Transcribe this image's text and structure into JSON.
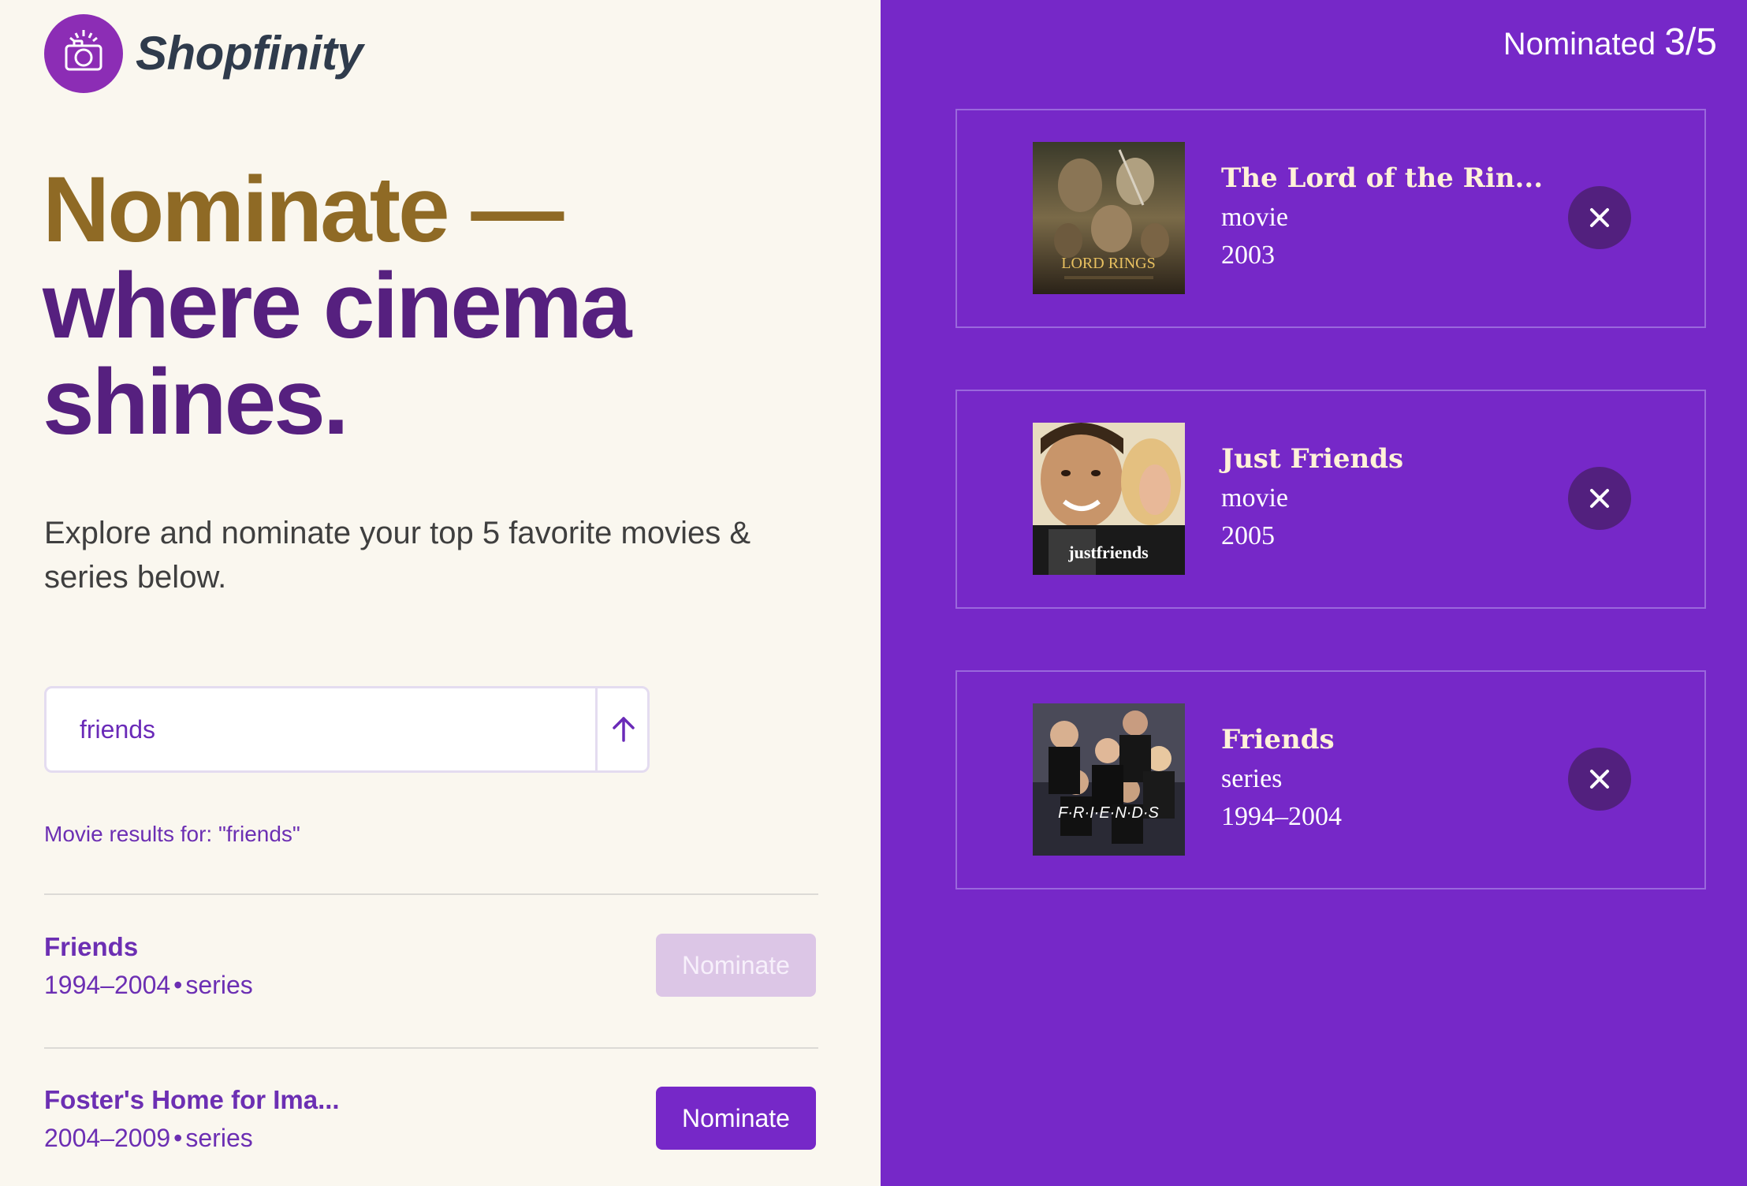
{
  "brand": {
    "name": "Shopfinity",
    "logo_icon": "camera-icon"
  },
  "hero": {
    "line1": "Nominate —",
    "line2": "where cinema",
    "line3": "shines.",
    "subtitle": "Explore and nominate your top 5 favorite movies & series below."
  },
  "search": {
    "value": "friends",
    "submit_icon": "arrow-up-icon"
  },
  "results": {
    "label": "Movie results for: \"friends\"",
    "items": [
      {
        "title": "Friends",
        "years": "1994–2004",
        "separator": "•",
        "type": "series",
        "button": "Nominate",
        "disabled": true
      },
      {
        "title": "Foster's Home for Ima...",
        "years": "2004–2009",
        "separator": "•",
        "type": "series",
        "button": "Nominate",
        "disabled": false
      }
    ]
  },
  "nominations": {
    "counter_label": "Nominated",
    "counter_value": "3/5",
    "items": [
      {
        "title": "The Lord of the Rin...",
        "type": "movie",
        "year": "2003",
        "poster_text": "LORD RINGS"
      },
      {
        "title": "Just Friends",
        "type": "movie",
        "year": "2005",
        "poster_text": "justfriends"
      },
      {
        "title": "Friends",
        "type": "series",
        "year": "1994–2004",
        "poster_text": "F·R·I·E·N·D·S"
      }
    ],
    "remove_icon": "close-icon"
  },
  "colors": {
    "accent_purple": "#7628c8",
    "dark_purple": "#52207e",
    "gold": "#8f6a25",
    "cream": "#faf7ef"
  }
}
